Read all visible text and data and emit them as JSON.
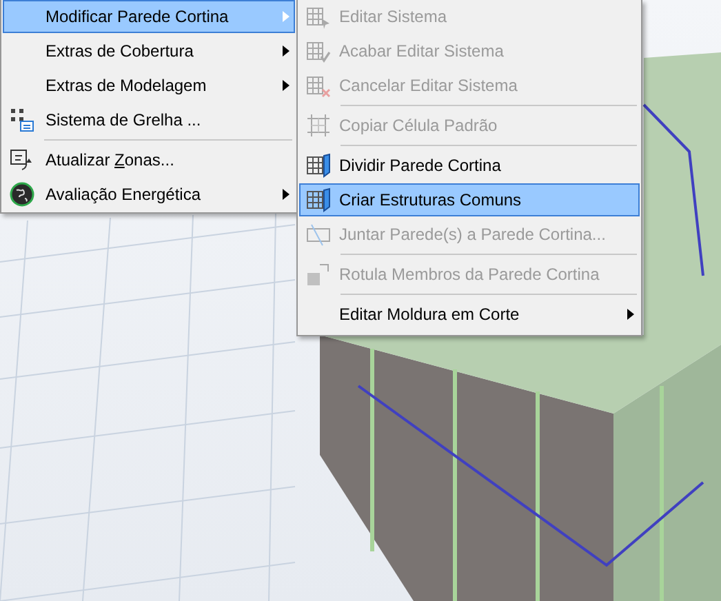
{
  "main_menu": {
    "items": [
      {
        "kind": "item",
        "label": "Modificar Parede Cortina",
        "submenu": true,
        "selected": true
      },
      {
        "kind": "item",
        "label": "Extras de Cobertura",
        "submenu": true,
        "selected": false
      },
      {
        "kind": "item",
        "label": "Extras de Modelagem",
        "submenu": true,
        "selected": false
      },
      {
        "kind": "item",
        "label": "Sistema de Grelha ...",
        "submenu": false,
        "selected": false
      },
      {
        "kind": "separator"
      },
      {
        "kind": "item",
        "label_before": "Atualizar ",
        "accelerator": "Z",
        "label_after": "onas...",
        "submenu": false,
        "selected": false
      },
      {
        "kind": "item",
        "label": "Avaliação Energética",
        "submenu": true,
        "selected": false
      }
    ]
  },
  "submenu": {
    "items": [
      {
        "kind": "item",
        "label": "Editar Sistema",
        "disabled": true,
        "submenu": false,
        "selected": false
      },
      {
        "kind": "item",
        "label": "Acabar Editar Sistema",
        "disabled": true,
        "submenu": false,
        "selected": false
      },
      {
        "kind": "item",
        "label": "Cancelar Editar Sistema",
        "disabled": true,
        "submenu": false,
        "selected": false
      },
      {
        "kind": "separator"
      },
      {
        "kind": "item",
        "label": "Copiar Célula Padrão",
        "disabled": true,
        "submenu": false,
        "selected": false
      },
      {
        "kind": "separator"
      },
      {
        "kind": "item",
        "label": "Dividir Parede Cortina",
        "disabled": false,
        "submenu": false,
        "selected": false
      },
      {
        "kind": "item",
        "label": "Criar Estruturas Comuns",
        "disabled": false,
        "submenu": false,
        "selected": true
      },
      {
        "kind": "item",
        "label": "Juntar Parede(s) a Parede Cortina...",
        "disabled": true,
        "submenu": false,
        "selected": false
      },
      {
        "kind": "separator"
      },
      {
        "kind": "item",
        "label": "Rotula Membros da Parede Cortina",
        "disabled": true,
        "submenu": false,
        "selected": false
      },
      {
        "kind": "separator"
      },
      {
        "kind": "item",
        "label": "Editar Moldura em Corte",
        "disabled": false,
        "submenu": true,
        "selected": false
      }
    ]
  }
}
